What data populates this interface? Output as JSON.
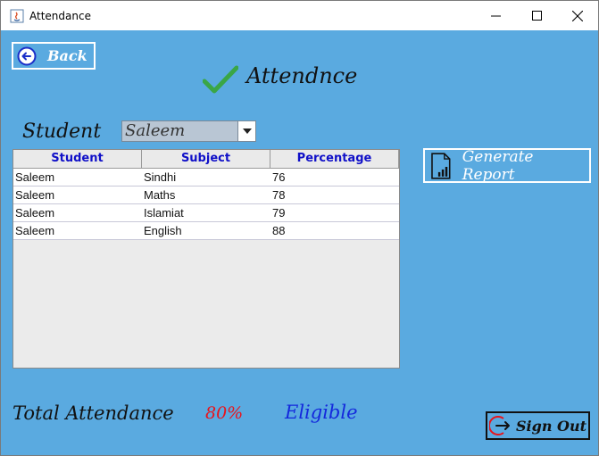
{
  "window": {
    "title": "Attendance"
  },
  "header": {
    "back_label": "Back",
    "page_title": "Attendnce"
  },
  "student_filter": {
    "label": "Student",
    "selected": "Saleem"
  },
  "table": {
    "columns": [
      "Student",
      "Subject",
      "Percentage"
    ],
    "rows": [
      [
        "Saleem",
        "Sindhi",
        "76"
      ],
      [
        "Saleem",
        "Maths",
        "78"
      ],
      [
        "Saleem",
        "Islamiat",
        "79"
      ],
      [
        "Saleem",
        "English",
        "88"
      ]
    ]
  },
  "actions": {
    "generate_report_label": "Generate Report",
    "sign_out_label": "Sign Out"
  },
  "summary": {
    "total_label": "Total Attendance",
    "percent": "80%",
    "status": "Eligible"
  },
  "colors": {
    "background": "#5aaae0",
    "header_text": "#1010c8",
    "percent": "#e8141c",
    "eligible": "#1428dc",
    "check": "#3aa646"
  },
  "icons": {
    "back": "back-arrow-circle-icon",
    "title": "checkmark-icon",
    "report": "document-chart-icon",
    "sign_out": "sign-out-icon",
    "dropdown": "triangle-down-icon"
  }
}
